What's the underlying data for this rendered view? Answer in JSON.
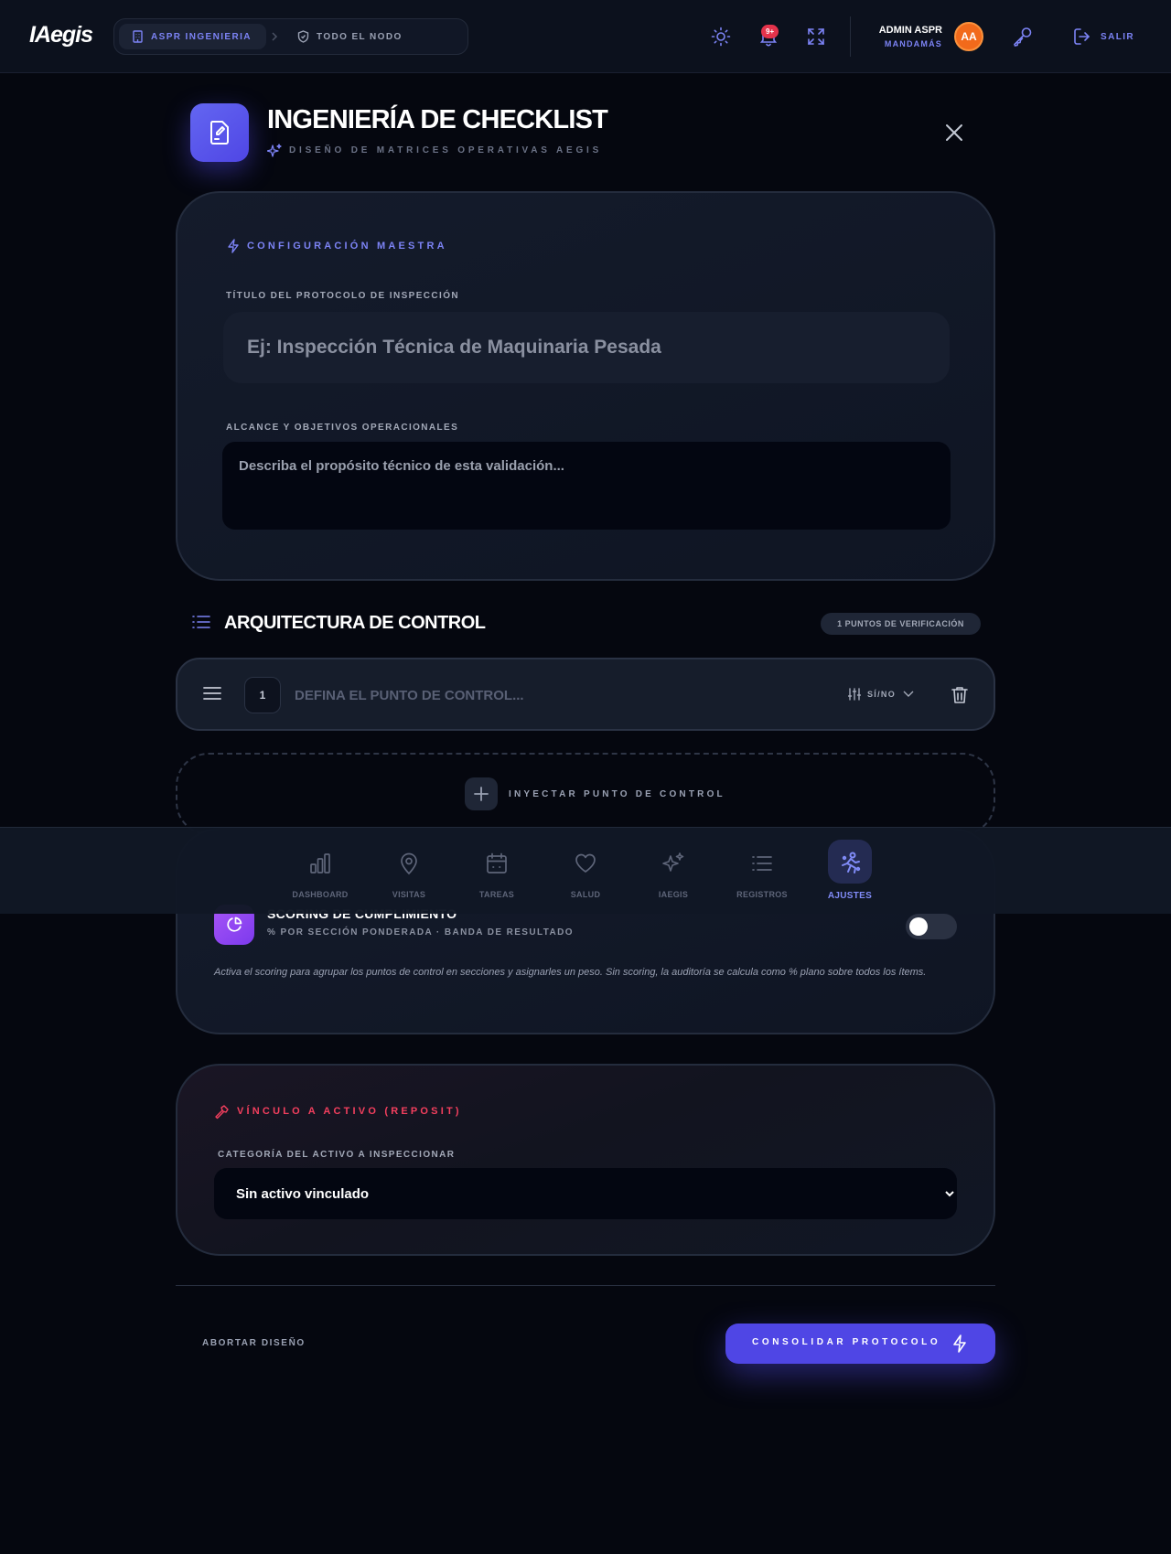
{
  "header": {
    "logo": "IAegis",
    "breadcrumb": {
      "org": "ASPR INGENIERIA",
      "node": "TODO EL NODO"
    },
    "notifications_badge": "9+",
    "user": {
      "name": "ADMIN ASPR",
      "role": "MANDAMÁS",
      "initials": "AA"
    },
    "logout_label": "SALIR"
  },
  "page": {
    "title": "INGENIERÍA DE CHECKLIST",
    "subtitle": "DISEÑO DE MATRICES OPERATIVAS AEGIS"
  },
  "config": {
    "section_label": "CONFIGURACIÓN MAESTRA",
    "title_label": "TÍTULO DEL PROTOCOLO DE INSPECCIÓN",
    "title_placeholder": "Ej: Inspección Técnica de Maquinaria Pesada",
    "title_value": "",
    "scope_label": "ALCANCE Y OBJETIVOS OPERACIONALES",
    "scope_placeholder": "Describa el propósito técnico de esta validación...",
    "scope_value": ""
  },
  "architecture": {
    "title": "ARQUITECTURA DE CONTROL",
    "count_label": "1 PUNTOS DE VERIFICACIÓN",
    "items": [
      {
        "number": "1",
        "placeholder": "DEFINA EL PUNTO DE CONTROL...",
        "value": "",
        "type": "SÍ/NO"
      }
    ],
    "inject_label": "INYECTAR PUNTO DE CONTROL"
  },
  "scoring": {
    "title": "SCORING DE CUMPLIMIENTO",
    "subtitle": "% POR SECCIÓN PONDERADA · BANDA DE RESULTADO",
    "enabled": false,
    "note": "Activa el scoring para agrupar los puntos de control en secciones y asignarles un peso. Sin scoring, la auditoría se calcula como % plano sobre todos los ítems."
  },
  "asset": {
    "section_label": "VÍNCULO A ACTIVO (REPOSIT)",
    "category_label": "CATEGORÍA DEL ACTIVO A INSPECCIONAR",
    "selected": "Sin activo vinculado"
  },
  "actions": {
    "abort": "ABORTAR DISEÑO",
    "consolidate": "CONSOLIDAR PROTOCOLO"
  },
  "bottom_nav": {
    "items": [
      {
        "label": "DASHBOARD",
        "icon": "bar-chart-icon"
      },
      {
        "label": "VISITAS",
        "icon": "map-pin-icon"
      },
      {
        "label": "TAREAS",
        "icon": "calendar-icon"
      },
      {
        "label": "SALUD",
        "icon": "heart-icon"
      },
      {
        "label": "IAEGIS",
        "icon": "sparkles-icon"
      },
      {
        "label": "REGISTROS",
        "icon": "list-icon"
      },
      {
        "label": "AJUSTES",
        "icon": "settings-person-icon"
      }
    ],
    "active": "AJUSTES"
  },
  "colors": {
    "accent": "#4f46e5",
    "accent_text": "#7c83f5",
    "asset_accent": "#f43f5e",
    "scoring_accent": "#a855f7",
    "background": "#05070f",
    "card": "#141b2b"
  }
}
